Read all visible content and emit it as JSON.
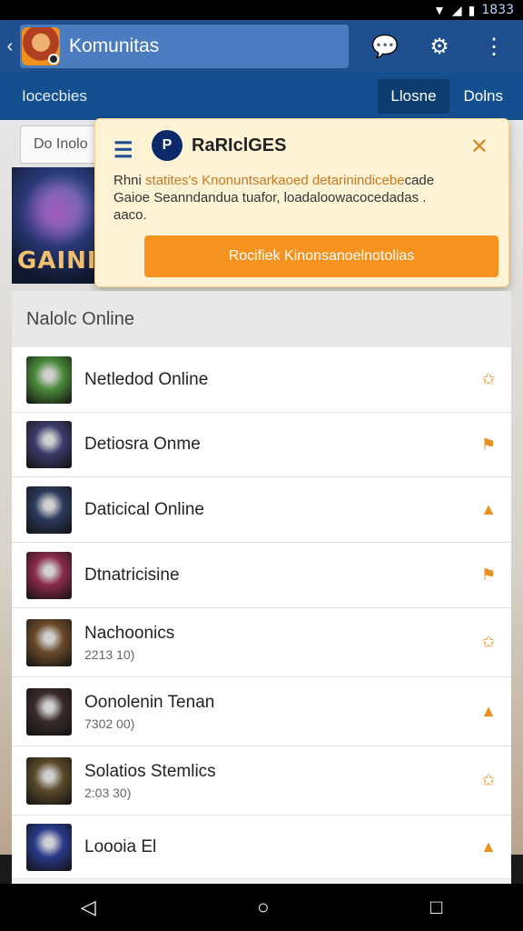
{
  "status_bar": {
    "clock": "1833",
    "wifi_icon": "wifi-icon",
    "signal_icon": "signal-icon",
    "battery_icon": "battery-icon"
  },
  "app_bar": {
    "back_icon": "back-arrow-icon",
    "title": "Komunitas",
    "chat_icon": "chat-icon",
    "settings_icon": "gear-icon",
    "menu_icon": "more-vertical-icon"
  },
  "sub_bar": {
    "label": "Iocecbies",
    "tab_active": "Llosne",
    "tab_other": "Dolns"
  },
  "search": {
    "value": "Do Inolo"
  },
  "banner": {
    "text": "GAINI"
  },
  "popup": {
    "menu_icon": "menu-icon",
    "logo_letter": "P",
    "title": "RaRIclGES",
    "close_icon": "dismiss-icon",
    "body_line1_plain": "Rhni ",
    "body_line1_accent": "statites's Knonuntsarkaoed detarinindicebe",
    "body_line1_end": "cade",
    "body_line2": "Gaioe Seanndandua tuafor, loadaloowacocedadas .",
    "body_line3": "aaco.",
    "button_label": "Rocifiek Kinonsanoelnotolias"
  },
  "list": {
    "section_title": "Nalolc Online",
    "items": [
      {
        "name": "Netledod Online",
        "sub": "",
        "thumb_color": "#4a8a3a",
        "icon": "star-icon"
      },
      {
        "name": "Detiosra Onme",
        "sub": "",
        "thumb_color": "#3a3a6a",
        "icon": "badge-icon"
      },
      {
        "name": "Daticical Online",
        "sub": "",
        "thumb_color": "#2a3a5a",
        "icon": "shop-icon"
      },
      {
        "name": "Dtnatricisine",
        "sub": "",
        "thumb_color": "#8a2a4a",
        "icon": "badge-icon"
      },
      {
        "name": "Nachoonics",
        "sub": "2213 10)",
        "thumb_color": "#6a4a2a",
        "icon": "star-icon"
      },
      {
        "name": "Oonolenin Tenan",
        "sub": "7302 00)",
        "thumb_color": "#3a2a2a",
        "icon": "shop-icon"
      },
      {
        "name": "Solatios Stemlics",
        "sub": "2:03 30)",
        "thumb_color": "#5a4a2a",
        "icon": "star-icon"
      },
      {
        "name": "Loooia El",
        "sub": "",
        "thumb_color": "#2a3a8a",
        "icon": "shop-icon"
      }
    ]
  },
  "nav": {
    "back_icon": "nav-back-icon",
    "home_icon": "nav-home-icon",
    "recents_icon": "nav-recents-icon"
  }
}
